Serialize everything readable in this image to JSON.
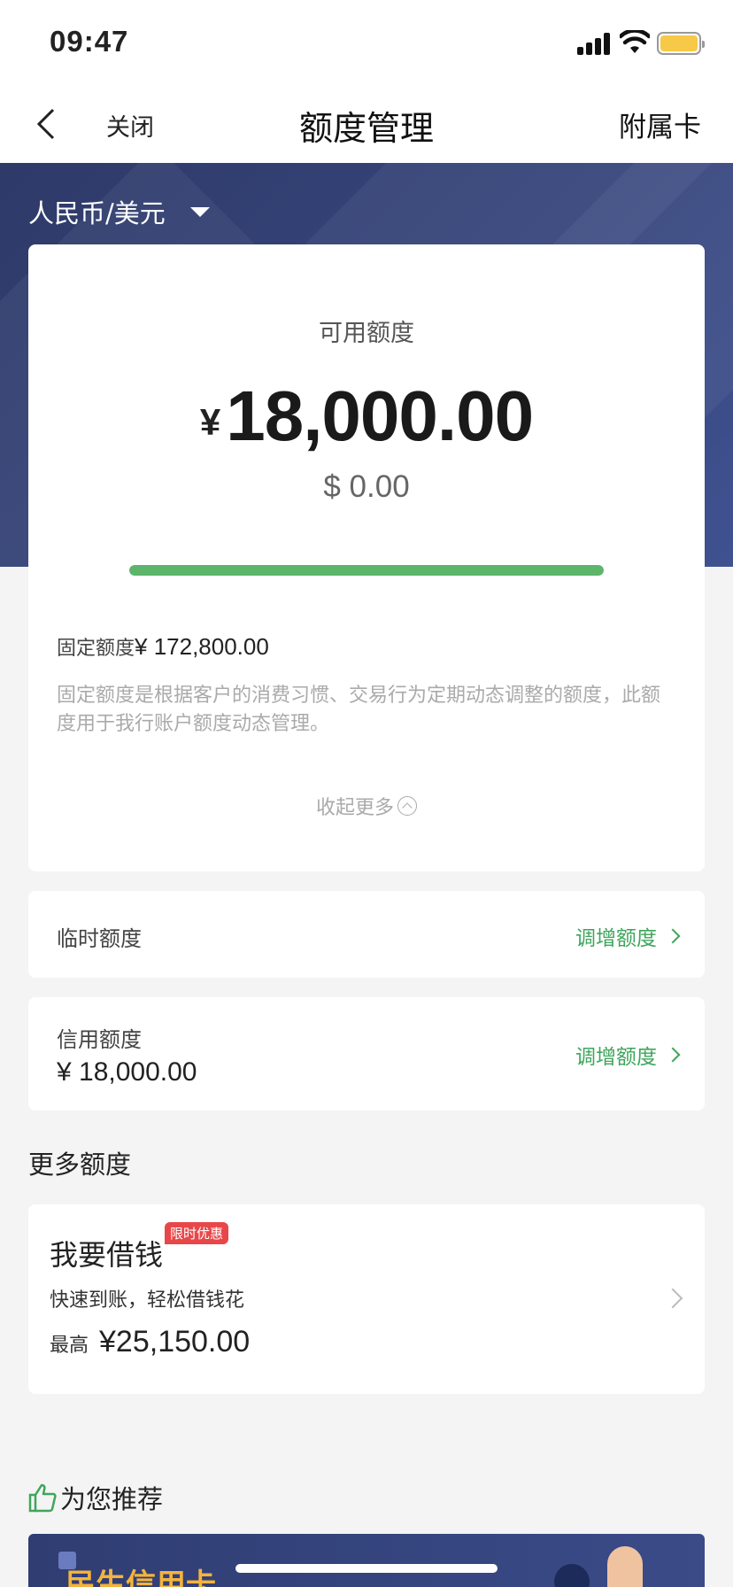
{
  "status_bar": {
    "time": "09:47"
  },
  "nav": {
    "close_label": "关闭",
    "title": "额度管理",
    "right_label": "附属卡"
  },
  "currency_selector": {
    "label": "人民币/美元"
  },
  "available": {
    "label": "可用额度",
    "symbol": "¥",
    "amount": "18,000.00",
    "usd": "$ 0.00",
    "usage_fraction": 1.0
  },
  "fixed": {
    "label": "固定额度",
    "value": "¥ 172,800.00",
    "description": "固定额度是根据客户的消费习惯、交易行为定期动态调整的额度，此额度用于我行账户额度动态管理。"
  },
  "collapse_label": "收起更多",
  "temporary": {
    "label": "临时额度",
    "action": "调增额度"
  },
  "credit": {
    "label": "信用额度",
    "value": "¥ 18,000.00",
    "action": "调增额度"
  },
  "more_section": {
    "title": "更多额度"
  },
  "loan": {
    "title": "我要借钱",
    "badge": "限时优惠",
    "subtitle": "快速到账，轻松借钱花",
    "max_label": "最高",
    "max_amount": "¥25,150.00"
  },
  "recommend": {
    "title": "为您推荐"
  },
  "banner": {
    "text": "民生信用卡"
  },
  "colors": {
    "accent_green": "#3fa55b",
    "progress_green": "#5cb56b",
    "hero_blue": "#36457c",
    "badge_red": "#e8474a"
  }
}
